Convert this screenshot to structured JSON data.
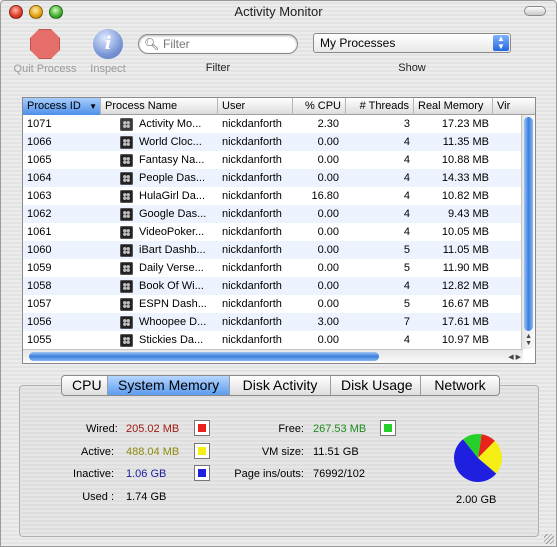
{
  "window": {
    "title": "Activity Monitor"
  },
  "toolbar": {
    "quit_label": "Quit Process",
    "inspect_label": "Inspect",
    "filter_placeholder": "Filter",
    "filter_label": "Filter",
    "show_label": "Show",
    "show_value": "My Processes"
  },
  "table": {
    "columns": [
      "Process ID",
      "Process Name",
      "User",
      "% CPU",
      "# Threads",
      "Real Memory",
      "Vir"
    ],
    "sorted_column": "Process ID",
    "rows": [
      {
        "pid": "1071",
        "name": "Activity Mo...",
        "user": "nickdanforth",
        "cpu": "2.30",
        "threads": "3",
        "mem": "17.23 MB",
        "icon": "activity-monitor-icon"
      },
      {
        "pid": "1066",
        "name": "World Cloc...",
        "user": "nickdanforth",
        "cpu": "0.00",
        "threads": "4",
        "mem": "11.35 MB",
        "icon": "dashboard-widget-icon"
      },
      {
        "pid": "1065",
        "name": "Fantasy Na...",
        "user": "nickdanforth",
        "cpu": "0.00",
        "threads": "4",
        "mem": "10.88 MB",
        "icon": "dashboard-widget-icon"
      },
      {
        "pid": "1064",
        "name": "People Das...",
        "user": "nickdanforth",
        "cpu": "0.00",
        "threads": "4",
        "mem": "14.33 MB",
        "icon": "dashboard-widget-icon"
      },
      {
        "pid": "1063",
        "name": "HulaGirl Da...",
        "user": "nickdanforth",
        "cpu": "16.80",
        "threads": "4",
        "mem": "10.82 MB",
        "icon": "dashboard-widget-icon"
      },
      {
        "pid": "1062",
        "name": "Google Das...",
        "user": "nickdanforth",
        "cpu": "0.00",
        "threads": "4",
        "mem": "9.43 MB",
        "icon": "dashboard-widget-icon"
      },
      {
        "pid": "1061",
        "name": "VideoPoker...",
        "user": "nickdanforth",
        "cpu": "0.00",
        "threads": "4",
        "mem": "10.05 MB",
        "icon": "dashboard-widget-icon"
      },
      {
        "pid": "1060",
        "name": "iBart Dashb...",
        "user": "nickdanforth",
        "cpu": "0.00",
        "threads": "5",
        "mem": "11.05 MB",
        "icon": "dashboard-widget-icon"
      },
      {
        "pid": "1059",
        "name": "Daily Verse...",
        "user": "nickdanforth",
        "cpu": "0.00",
        "threads": "5",
        "mem": "11.90 MB",
        "icon": "dashboard-widget-icon"
      },
      {
        "pid": "1058",
        "name": "Book Of Wi...",
        "user": "nickdanforth",
        "cpu": "0.00",
        "threads": "4",
        "mem": "12.82 MB",
        "icon": "dashboard-widget-icon"
      },
      {
        "pid": "1057",
        "name": "ESPN Dash...",
        "user": "nickdanforth",
        "cpu": "0.00",
        "threads": "5",
        "mem": "16.67 MB",
        "icon": "dashboard-widget-icon"
      },
      {
        "pid": "1056",
        "name": "Whoopee D...",
        "user": "nickdanforth",
        "cpu": "3.00",
        "threads": "7",
        "mem": "17.61 MB",
        "icon": "dashboard-widget-icon"
      },
      {
        "pid": "1055",
        "name": "Stickies Da...",
        "user": "nickdanforth",
        "cpu": "0.00",
        "threads": "4",
        "mem": "10.97 MB",
        "icon": "dashboard-widget-icon"
      }
    ]
  },
  "tabs": [
    "CPU",
    "System Memory",
    "Disk Activity",
    "Disk Usage",
    "Network"
  ],
  "active_tab": "System Memory",
  "memory": {
    "wired_label": "Wired:",
    "wired_value": "205.02 MB",
    "active_label": "Active:",
    "active_value": "488.04 MB",
    "inactive_label": "Inactive:",
    "inactive_value": "1.06 GB",
    "used_label": "Used :",
    "used_value": "1.74 GB",
    "free_label": "Free:",
    "free_value": "267.53 MB",
    "vmsize_label": "VM size:",
    "vmsize_value": "11.51 GB",
    "pageins_label": "Page ins/outs:",
    "pageins_value": "76992/102",
    "total_label": "2.00 GB"
  },
  "memory_chart": {
    "slices": [
      {
        "name": "Wired",
        "value": 205.02
      },
      {
        "name": "Active",
        "value": 488.04
      },
      {
        "name": "Inactive",
        "value": 1085.44
      },
      {
        "name": "Free",
        "value": 267.53
      }
    ]
  },
  "colors": {
    "wired": "#e8231c",
    "active": "#f4ee15",
    "inactive": "#1f1fe0",
    "free": "#25d02a",
    "wired_text": "#a01a14",
    "active_text": "#8f8a12",
    "inactive_text": "#1a1aa0",
    "free_text": "#1e8a1e"
  }
}
